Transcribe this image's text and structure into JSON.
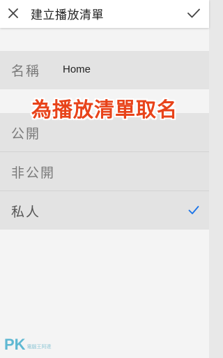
{
  "header": {
    "title": "建立播放清單",
    "close_icon": "close-icon",
    "confirm_icon": "check-icon"
  },
  "name_field": {
    "label": "名稱",
    "value": "Home"
  },
  "caption": "為播放清單取名",
  "privacy_options": [
    {
      "label": "公開",
      "selected": false
    },
    {
      "label": "非公開",
      "selected": false
    },
    {
      "label": "私人",
      "selected": true
    }
  ],
  "watermark": {
    "logo": "PK",
    "text": "電腦王阿達"
  },
  "colors": {
    "accent": "#1a73e8",
    "caption": "#e8431a",
    "row_bg": "#e3e3e3"
  }
}
